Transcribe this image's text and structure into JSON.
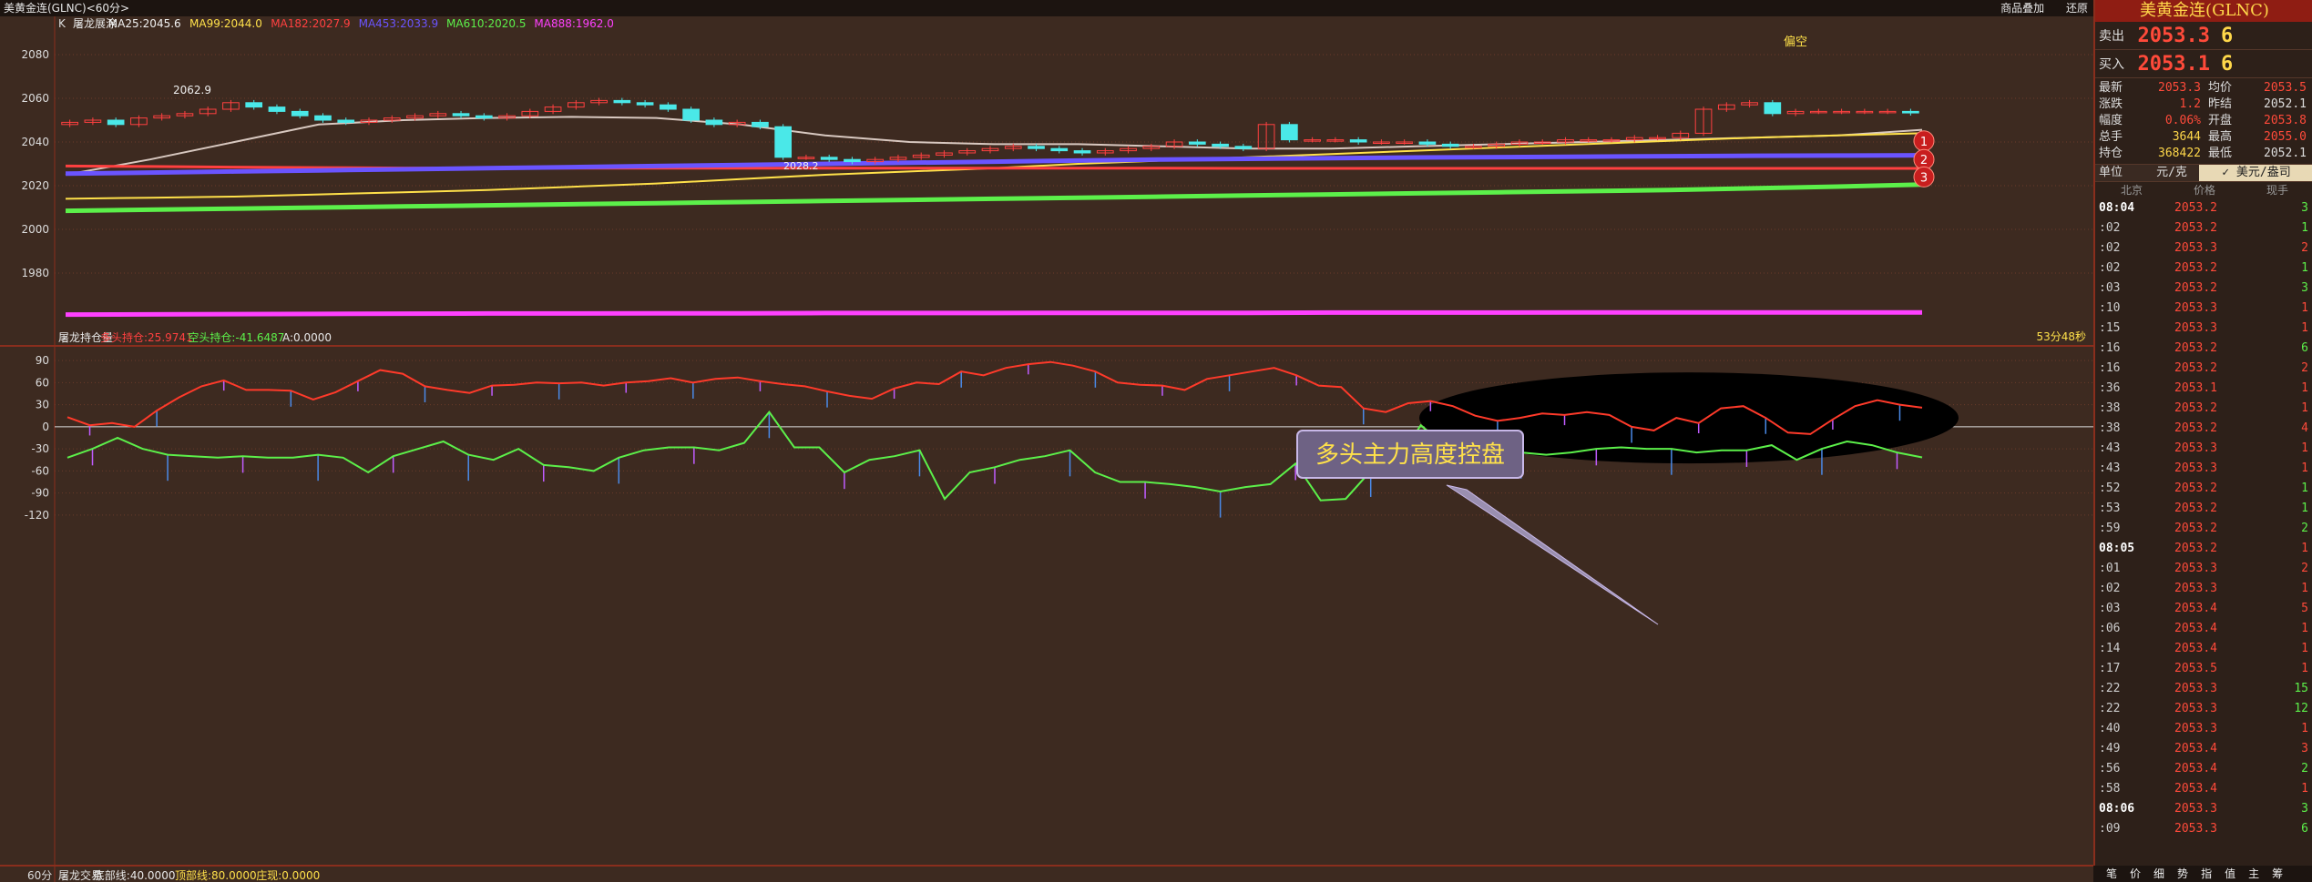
{
  "window": {
    "title": "美黄金连(GLNC)<60分>",
    "btn_overlay": "商品叠加",
    "btn_restore": "还原"
  },
  "main_panel": {
    "legend_prefix": "K",
    "legend": [
      {
        "text": "屠龙展涂",
        "color": "#e8e8e8"
      },
      {
        "text": "MA25:2045.6",
        "color": "#f2f2f2"
      },
      {
        "text": "MA99:2044.0",
        "color": "#ffe14a"
      },
      {
        "text": "MA182:2027.9",
        "color": "#ff4040"
      },
      {
        "text": "MA453:2033.9",
        "color": "#6a54ff"
      },
      {
        "text": "MA610:2020.5",
        "color": "#5cf04a"
      },
      {
        "text": "MA888:1962.0",
        "color": "#ff40ff"
      }
    ],
    "y_ticks": [
      "2080",
      "2060",
      "2040",
      "2020",
      "2000",
      "1980"
    ],
    "high_label": "2062.9",
    "low_label": "2028.2",
    "tag": "偏空",
    "timer": "53分48秒",
    "markers": [
      "1",
      "2",
      "3"
    ],
    "callout": "多头主力高度控盘"
  },
  "sub_panel": {
    "legend": [
      {
        "text": "屠龙持仓量",
        "color": "#e8e8e8"
      },
      {
        "text": "多头持仓:25.9741",
        "color": "#ff4040"
      },
      {
        "text": "空头持仓:-41.6487",
        "color": "#5cf04a"
      },
      {
        "text": "A:0.0000",
        "color": "#e8e8e8"
      }
    ],
    "y_ticks": [
      "90",
      "60",
      "30",
      "0",
      "-30",
      "-60",
      "-90",
      "-120"
    ]
  },
  "bottom_indicator": {
    "period": "60分",
    "legend": [
      {
        "text": "屠龙交易",
        "color": "#e8e8e8"
      },
      {
        "text": "底部线:40.0000",
        "color": "#e8e8e8"
      },
      {
        "text": "顶部线:80.0000",
        "color": "#ffe14a"
      },
      {
        "text": "庄现:0.0000",
        "color": "#ffe14a"
      }
    ]
  },
  "side": {
    "header": "美黄金连(GLNC)",
    "sell": {
      "label": "卖出",
      "price": "2053.3",
      "vol": "6"
    },
    "buy": {
      "label": "买入",
      "price": "2053.1",
      "vol": "6"
    },
    "stats": [
      {
        "k": "最新",
        "v": "2053.3",
        "vc": "#ff4a3a",
        "k2": "均价",
        "v2": "2053.5",
        "v2c": "#ff4a3a"
      },
      {
        "k": "涨跌",
        "v": "1.2",
        "vc": "#ff4a3a",
        "k2": "昨结",
        "v2": "2052.1",
        "v2c": "#ddd"
      },
      {
        "k": "幅度",
        "v": "0.06%",
        "vc": "#ff4a3a",
        "k2": "开盘",
        "v2": "2053.8",
        "v2c": "#ff4a3a"
      },
      {
        "k": "总手",
        "v": "3644",
        "vc": "#ffd84a",
        "k2": "最高",
        "v2": "2055.0",
        "v2c": "#ff4a3a"
      },
      {
        "k": "持仓",
        "v": "368422",
        "vc": "#ffd84a",
        "k2": "最低",
        "v2": "2052.1",
        "v2c": "#ddd"
      }
    ],
    "unit": {
      "label": "单位",
      "a": "元/克",
      "b": "✓ 美元/盎司"
    },
    "tick_header": [
      "北京",
      "价格",
      "现手"
    ],
    "ticks": [
      {
        "t": "08:04",
        "p": "2053.2",
        "v": "3",
        "c": "#5cf04a",
        "bold": true
      },
      {
        "t": ":02",
        "p": "2053.2",
        "v": "1",
        "c": "#5cf04a"
      },
      {
        "t": ":02",
        "p": "2053.3",
        "v": "2",
        "c": "#ff4a3a"
      },
      {
        "t": ":02",
        "p": "2053.2",
        "v": "1",
        "c": "#5cf04a"
      },
      {
        "t": ":03",
        "p": "2053.2",
        "v": "3",
        "c": "#5cf04a"
      },
      {
        "t": ":10",
        "p": "2053.3",
        "v": "1",
        "c": "#ff4a3a"
      },
      {
        "t": ":15",
        "p": "2053.3",
        "v": "1",
        "c": "#ff4a3a"
      },
      {
        "t": ":16",
        "p": "2053.2",
        "v": "6",
        "c": "#5cf04a"
      },
      {
        "t": ":16",
        "p": "2053.2",
        "v": "2",
        "c": "#ff4a3a"
      },
      {
        "t": ":36",
        "p": "2053.1",
        "v": "1",
        "c": "#ff4a3a"
      },
      {
        "t": ":38",
        "p": "2053.2",
        "v": "1",
        "c": "#ff4a3a"
      },
      {
        "t": ":38",
        "p": "2053.2",
        "v": "4",
        "c": "#ff4a3a"
      },
      {
        "t": ":43",
        "p": "2053.3",
        "v": "1",
        "c": "#ff4a3a"
      },
      {
        "t": ":43",
        "p": "2053.3",
        "v": "1",
        "c": "#ff4a3a"
      },
      {
        "t": ":52",
        "p": "2053.2",
        "v": "1",
        "c": "#5cf04a"
      },
      {
        "t": ":53",
        "p": "2053.2",
        "v": "1",
        "c": "#5cf04a"
      },
      {
        "t": ":59",
        "p": "2053.2",
        "v": "2",
        "c": "#5cf04a"
      },
      {
        "t": "08:05",
        "p": "2053.2",
        "v": "1",
        "c": "#ff4a3a",
        "bold": true
      },
      {
        "t": ":01",
        "p": "2053.3",
        "v": "2",
        "c": "#ff4a3a"
      },
      {
        "t": ":02",
        "p": "2053.3",
        "v": "1",
        "c": "#ff4a3a"
      },
      {
        "t": ":03",
        "p": "2053.4",
        "v": "5",
        "c": "#ff4a3a"
      },
      {
        "t": ":06",
        "p": "2053.4",
        "v": "1",
        "c": "#ff4a3a"
      },
      {
        "t": ":14",
        "p": "2053.4",
        "v": "1",
        "c": "#ff4a3a"
      },
      {
        "t": ":17",
        "p": "2053.5",
        "v": "1",
        "c": "#ff4a3a"
      },
      {
        "t": ":22",
        "p": "2053.3",
        "v": "15",
        "c": "#5cf04a"
      },
      {
        "t": ":22",
        "p": "2053.3",
        "v": "12",
        "c": "#5cf04a"
      },
      {
        "t": ":40",
        "p": "2053.3",
        "v": "1",
        "c": "#ff4a3a"
      },
      {
        "t": ":49",
        "p": "2053.4",
        "v": "3",
        "c": "#ff4a3a"
      },
      {
        "t": ":56",
        "p": "2053.4",
        "v": "2",
        "c": "#5cf04a"
      },
      {
        "t": ":58",
        "p": "2053.4",
        "v": "1",
        "c": "#ff4a3a"
      },
      {
        "t": "08:06",
        "p": "2053.3",
        "v": "3",
        "c": "#5cf04a",
        "bold": true
      },
      {
        "t": ":09",
        "p": "2053.3",
        "v": "6",
        "c": "#5cf04a"
      }
    ],
    "bottom_tabs": [
      "笔",
      "价",
      "细",
      "势",
      "指",
      "值",
      "主",
      "筹"
    ]
  },
  "chart_data": [
    {
      "type": "candlestick",
      "title": "美黄金连(GLNC) 60分",
      "y_range": [
        1960,
        2085
      ],
      "ma_series": [
        {
          "name": "MA25",
          "color": "#d8c8c0",
          "values": [
            2025.0,
            2032,
            2040,
            2048,
            2050,
            2051,
            2051.5,
            2051,
            2048,
            2043,
            2040,
            2039,
            2039,
            2038,
            2037,
            2037,
            2038,
            2039,
            2040,
            2041,
            2042,
            2043,
            2045.6
          ]
        },
        {
          "name": "MA99",
          "color": "#ffe14a",
          "values": [
            2014,
            2014.5,
            2015,
            2016,
            2017,
            2018,
            2019.5,
            2021,
            2023,
            2025,
            2026.5,
            2028,
            2030,
            2031.5,
            2033,
            2034.5,
            2036,
            2037.5,
            2039,
            2040.5,
            2042,
            2043,
            2044.0
          ]
        },
        {
          "name": "MA182",
          "color": "#ff4040",
          "values": [
            2029,
            2028.8,
            2028.5,
            2028.3,
            2028.1,
            2028,
            2028,
            2028,
            2028,
            2028,
            2028,
            2028,
            2028,
            2028,
            2027.9,
            2027.9,
            2027.9,
            2027.9,
            2027.9,
            2027.9,
            2027.9,
            2027.9,
            2027.9
          ]
        },
        {
          "name": "MA453",
          "color": "#6a54ff",
          "values": [
            2025.5,
            2026,
            2026.5,
            2027,
            2027.5,
            2028,
            2028.5,
            2029,
            2029.5,
            2030,
            2030.5,
            2031,
            2031.5,
            2032,
            2032.3,
            2032.6,
            2032.9,
            2033.1,
            2033.3,
            2033.5,
            2033.7,
            2033.8,
            2033.9
          ]
        },
        {
          "name": "MA610",
          "color": "#5cf04a",
          "values": [
            2008.5,
            2009,
            2009.5,
            2010,
            2010.5,
            2011,
            2011.5,
            2012,
            2012.5,
            2013,
            2013.5,
            2014,
            2014.5,
            2015,
            2015.5,
            2016,
            2016.5,
            2017,
            2017.5,
            2018,
            2018.8,
            2019.6,
            2020.5
          ]
        },
        {
          "name": "MA888",
          "color": "#ff40ff",
          "values": [
            1961.0,
            1961.1,
            1961.2,
            1961.3,
            1961.4,
            1961.5,
            1961.5,
            1961.6,
            1961.6,
            1961.7,
            1961.7,
            1961.7,
            1961.8,
            1961.8,
            1961.8,
            1961.9,
            1961.9,
            1961.9,
            1962.0,
            1962.0,
            1962.0,
            1962.0,
            1962.0
          ]
        }
      ],
      "closes": [
        2049,
        2050,
        2048,
        2051,
        2052,
        2053,
        2055,
        2058,
        2056,
        2054,
        2052,
        2050,
        2049,
        2050,
        2051,
        2052,
        2053,
        2052,
        2051,
        2052,
        2054,
        2056,
        2058,
        2059,
        2058,
        2057,
        2055,
        2050,
        2048,
        2049,
        2047,
        2033,
        2033,
        2032,
        2031,
        2032,
        2033,
        2034,
        2035,
        2036,
        2037,
        2038,
        2037,
        2036,
        2035,
        2036,
        2037,
        2038,
        2040,
        2039,
        2038,
        2037,
        2048,
        2041,
        2041,
        2041,
        2040,
        2040,
        2040,
        2039,
        2038,
        2038,
        2039,
        2040,
        2040,
        2041,
        2041,
        2041,
        2042,
        2042,
        2044,
        2055,
        2057,
        2058,
        2053,
        2054,
        2054,
        2054,
        2054,
        2054,
        2053.3
      ]
    },
    {
      "type": "line",
      "title": "屠龙持仓量",
      "y_range": [
        -135,
        100
      ],
      "series": [
        {
          "name": "多头持仓",
          "color": "#ff3a2a",
          "values": [
            13,
            2,
            5,
            0,
            22,
            40,
            55,
            63,
            50,
            50,
            49,
            37,
            47,
            62,
            77,
            72,
            55,
            50,
            46,
            56,
            57,
            60,
            59,
            60,
            56,
            60,
            62,
            66,
            60,
            65,
            67,
            62,
            58,
            55,
            48,
            42,
            38,
            52,
            60,
            58,
            75,
            70,
            80,
            85,
            88,
            83,
            75,
            60,
            57,
            56,
            50,
            65,
            70,
            75,
            80,
            70,
            56,
            54,
            25,
            20,
            32,
            35,
            28,
            15,
            8,
            12,
            18,
            16,
            20,
            16,
            0,
            -5,
            12,
            5,
            25,
            28,
            12,
            -8,
            -10,
            10,
            28,
            36,
            30,
            25.97
          ]
        },
        {
          "name": "空头持仓",
          "color": "#5cf04a",
          "values": [
            -42,
            -30,
            -15,
            -30,
            -38,
            -40,
            -42,
            -40,
            -42,
            -42,
            -38,
            -42,
            -62,
            -40,
            -30,
            -20,
            -38,
            -45,
            -30,
            -52,
            -55,
            -60,
            -42,
            -32,
            -28,
            -28,
            -32,
            -22,
            20,
            -28,
            -28,
            -62,
            -45,
            -40,
            -32,
            -98,
            -62,
            -55,
            -45,
            -40,
            -32,
            -62,
            -75,
            -75,
            -78,
            -82,
            -88,
            -82,
            -78,
            -50,
            -100,
            -98,
            -60,
            -50,
            2,
            -28,
            -30,
            -32,
            -35,
            -38,
            -35,
            -30,
            -28,
            -30,
            -30,
            -35,
            -32,
            -32,
            -25,
            -45,
            -30,
            -20,
            -25,
            -35,
            -41.65
          ]
        }
      ]
    }
  ]
}
